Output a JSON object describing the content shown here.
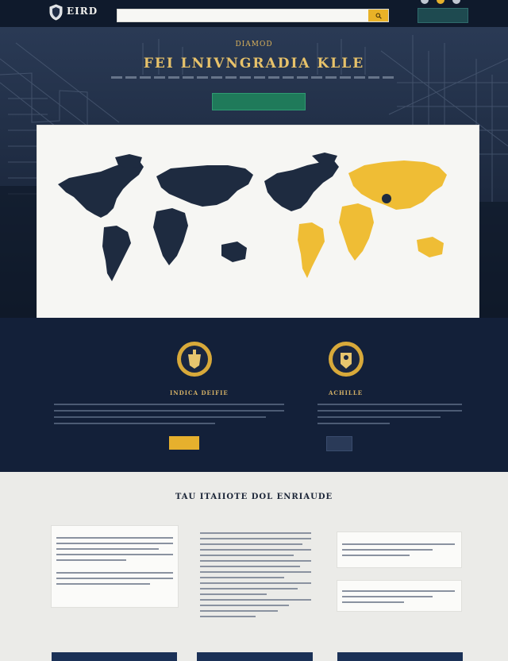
{
  "header": {
    "logo_title": "EIRD",
    "logo_subtitle": "",
    "search_placeholder": "",
    "top_links": [
      "",
      "",
      ""
    ],
    "cta_label": ""
  },
  "hero": {
    "kicker": "DIAMOD",
    "title": "FEI LNIVNGRADIA KLLE",
    "cta_label": ""
  },
  "features": {
    "left": {
      "title": "INDICA DEIFIE",
      "button": ""
    },
    "right": {
      "title": "ACHILLE",
      "button": ""
    }
  },
  "light_section": {
    "title": "TAU ITAIIOTE DOL ENRIAUDE",
    "panels": [
      "",
      "",
      "",
      ""
    ]
  },
  "footer_tabs": [
    "",
    "",
    ""
  ],
  "colors": {
    "navy": "#132039",
    "gold": "#e6b02d",
    "map_dark": "#1e2b40",
    "map_gold": "#efbd35"
  }
}
